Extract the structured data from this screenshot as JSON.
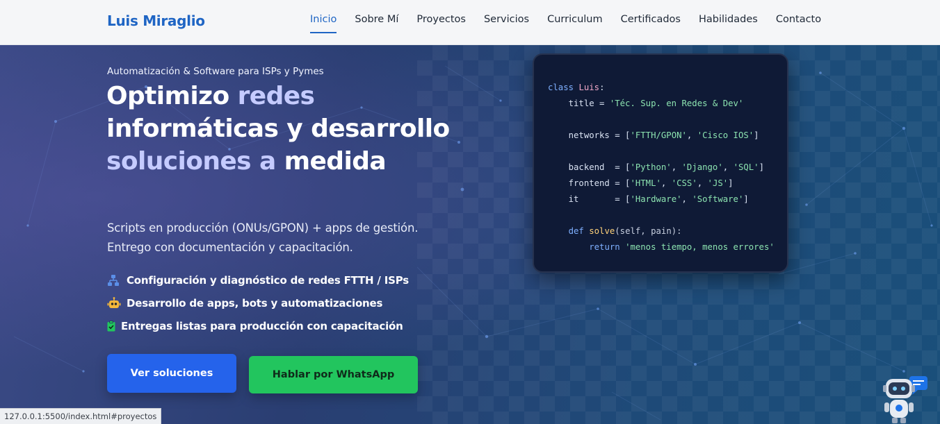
{
  "navbar": {
    "brand": "Luis Miraglio",
    "links": [
      {
        "label": "Inicio",
        "active": true
      },
      {
        "label": "Sobre Mí",
        "active": false
      },
      {
        "label": "Proyectos",
        "active": false
      },
      {
        "label": "Servicios",
        "active": false
      },
      {
        "label": "Curriculum",
        "active": false
      },
      {
        "label": "Certificados",
        "active": false
      },
      {
        "label": "Habilidades",
        "active": false
      },
      {
        "label": "Contacto",
        "active": false
      }
    ]
  },
  "hero": {
    "tagline": "Automatización & Software para ISPs y Pymes",
    "title_parts": {
      "p1": "Optimizo ",
      "p2": "redes",
      "p3": " informáticas y desarrollo ",
      "p4": "soluciones a",
      "p5": " medida"
    },
    "subtitle_line1": "Scripts en producción (ONUs/GPON) + apps de gestión.",
    "subtitle_line2": "Entrego con documentación y capacitación.",
    "features": [
      {
        "icon": "network-icon",
        "text": "Configuración y diagnóstico de redes FTTH / ISPs"
      },
      {
        "icon": "robot-icon",
        "text": "Desarrollo de apps, bots y automatizaciones"
      },
      {
        "icon": "clipboard-check-icon",
        "text": "Entregas listas para producción con capacitación"
      }
    ],
    "btn_primary": "Ver soluciones",
    "btn_whatsapp": "Hablar por WhatsApp"
  },
  "code": {
    "l1_kw": "class",
    "l1_name": "Luis",
    "l1_colon": ":",
    "l2_pre": "    title = ",
    "l2_str": "'Téc. Sup. en Redes & Dev'",
    "l3_pre": "    networks = [",
    "l3_s1": "'FTTH/GPON'",
    "l3_sep": ", ",
    "l3_s2": "'Cisco IOS'",
    "l3_post": "]",
    "l4_pre": "    backend  = [",
    "l4_s1": "'Python'",
    "l4_s2": "'Django'",
    "l4_s3": "'SQL'",
    "l4_post": "]",
    "l5_pre": "    frontend = [",
    "l5_s1": "'HTML'",
    "l5_s2": "'CSS'",
    "l5_s3": "'JS'",
    "l5_post": "]",
    "l6_pre": "    it       = [",
    "l6_s1": "'Hardware'",
    "l6_s2": "'Software'",
    "l6_post": "]",
    "l7_indent": "    ",
    "l7_kw": "def",
    "l7_fn": "solve",
    "l7_params": "(self, pain):",
    "l8_indent": "        ",
    "l8_kw": "return",
    "l8_str": "'menos tiempo, menos errores'"
  },
  "statusbar": {
    "url": "127.0.0.1:5500/index.html#proyectos"
  },
  "colors": {
    "brand": "#1f65c4",
    "primary_button": "#2563eb",
    "whatsapp_button": "#22c55e",
    "hero_highlight": "#c5cbff"
  }
}
